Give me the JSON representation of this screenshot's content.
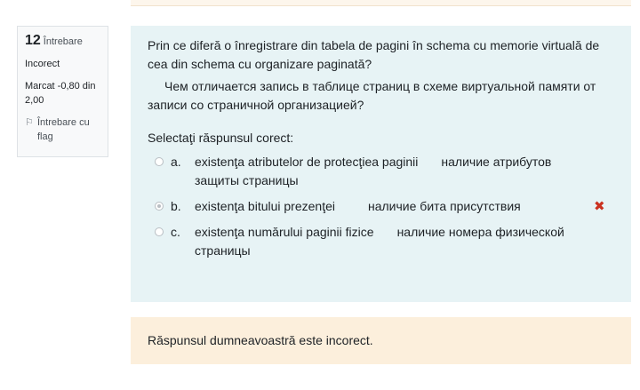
{
  "question": {
    "number": "12",
    "number_label": "Întrebare",
    "state": "Incorect",
    "grade": "Marcat -0,80 din 2,00",
    "flag_label": "Întrebare cu flag"
  },
  "formulation": {
    "text_ro": "Prin ce diferă o înregistrare din tabela de pagini în schema cu memorie virtuală de cea din schema cu organizare paginată?",
    "text_ru": "Чем отличается запись в таблице страниц в схеме виртуальной памяти от записи со страничной организацией?",
    "prompt": "Selectaţi răspunsul corect:",
    "answers": [
      {
        "letter": "a.",
        "text_ro": "existenţa atributelor de protecţiea paginii",
        "text_ru": "наличие атрибутов защиты страницы",
        "selected": false
      },
      {
        "letter": "b.",
        "text_ro": "existenţa bitului prezenţei",
        "text_ru": "наличие бита присутствия",
        "selected": true,
        "mark": "incorrect-icon"
      },
      {
        "letter": "c.",
        "text_ro": "existenţa numărului paginii fizice",
        "text_ru": "наличие номера физической страницы",
        "selected": false
      }
    ]
  },
  "feedback": {
    "text": "Răspunsul dumneavoastră este incorect."
  },
  "colors": {
    "info_bg": "#f8f9fa",
    "formulation_bg": "#e7f3f5",
    "feedback_bg": "#fcefdc",
    "incorrect": "#ca3120"
  }
}
